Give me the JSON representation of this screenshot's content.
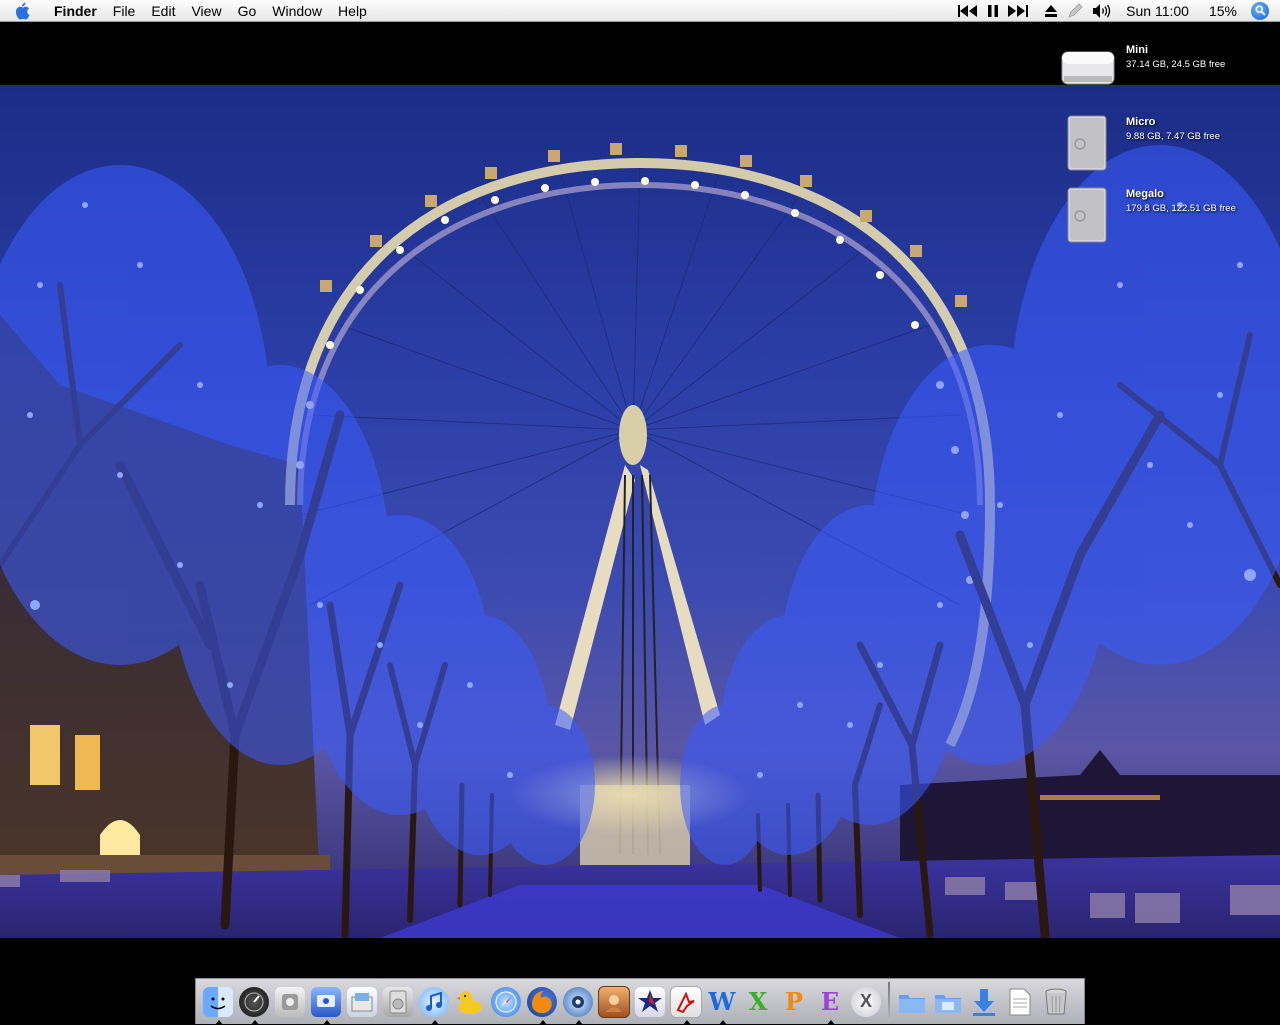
{
  "menubar": {
    "app_name": "Finder",
    "menus": [
      "File",
      "Edit",
      "View",
      "Go",
      "Window",
      "Help"
    ],
    "clock": "Sun 11:00",
    "battery": "15%",
    "status_icons": [
      "previous-track-icon",
      "pause-icon",
      "next-track-icon",
      "eject-icon",
      "script-icon",
      "volume-icon",
      "spotlight-icon"
    ]
  },
  "volumes": [
    {
      "name": "Mini",
      "info": "37.14 GB, 24.5 GB free"
    },
    {
      "name": "Micro",
      "info": "9.88 GB, 7.47 GB free"
    },
    {
      "name": "Megalo",
      "info": "179.8 GB, 122.51 GB free"
    }
  ],
  "dock": {
    "apps": [
      {
        "id": "finder",
        "running": true
      },
      {
        "id": "dashboard",
        "running": true
      },
      {
        "id": "system-preferences",
        "running": false
      },
      {
        "id": "ichat",
        "running": true
      },
      {
        "id": "preview",
        "running": false
      },
      {
        "id": "dvd-player",
        "running": false
      },
      {
        "id": "itunes",
        "running": true
      },
      {
        "id": "cyberduck",
        "running": false
      },
      {
        "id": "safari",
        "running": false
      },
      {
        "id": "firefox",
        "running": true
      },
      {
        "id": "camino",
        "running": true
      },
      {
        "id": "photo-app",
        "running": false
      },
      {
        "id": "star-app",
        "running": false
      },
      {
        "id": "acrobat",
        "running": true
      },
      {
        "id": "word",
        "running": true
      },
      {
        "id": "excel",
        "running": false
      },
      {
        "id": "powerpoint",
        "running": false
      },
      {
        "id": "entourage",
        "running": true
      },
      {
        "id": "x11",
        "running": false
      }
    ],
    "docs": [
      {
        "id": "applications-folder"
      },
      {
        "id": "documents-folder"
      },
      {
        "id": "downloads-folder"
      },
      {
        "id": "text-document"
      },
      {
        "id": "trash"
      }
    ]
  },
  "colors": {
    "menubar": "#ececec",
    "sky": "#2b3fa8",
    "tree_lights": "#3b5bff",
    "wheel_lights": "#fff6c8"
  }
}
